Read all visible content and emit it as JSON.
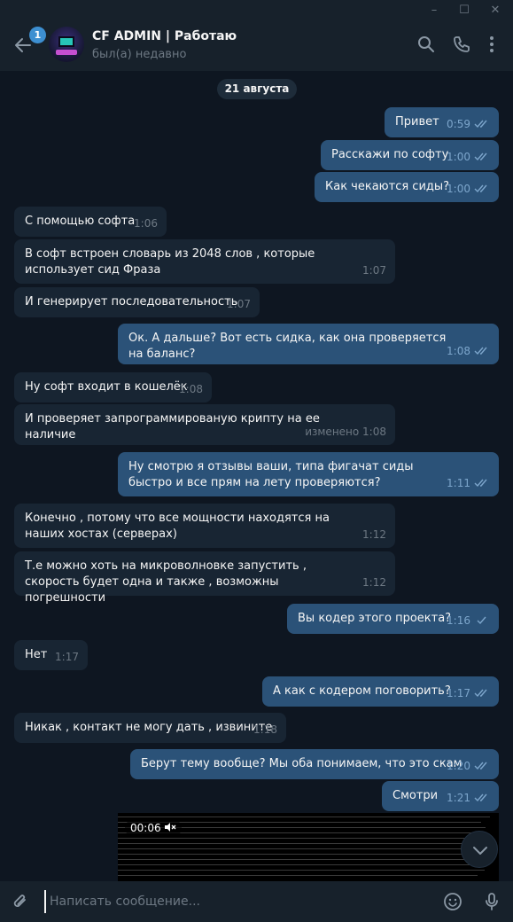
{
  "header": {
    "title": "CF ADMIN | Работаю",
    "status": "был(а) недавно",
    "unread_badge": "1"
  },
  "date_separator": "21 августа",
  "messages": [
    {
      "dir": "out",
      "text": "Привет",
      "time": "0:59",
      "read": true
    },
    {
      "dir": "out",
      "text": "Расскажи по софту",
      "time": "1:00",
      "read": true
    },
    {
      "dir": "out",
      "text": "Как чекаются сиды?",
      "time": "1:00",
      "read": true
    },
    {
      "dir": "in",
      "text": "С помощью софта",
      "time": "1:06"
    },
    {
      "dir": "in",
      "text": "В софт встроен словарь из 2048 слов , которые использует сид Фраза",
      "time": "1:07"
    },
    {
      "dir": "in",
      "text": "И генерирует последовательность",
      "time": "1:07"
    },
    {
      "dir": "out",
      "text": "Ок. А дальше? Вот есть сидка, как она проверяется на баланс?",
      "time": "1:08",
      "read": true
    },
    {
      "dir": "in",
      "text": "Ну софт входит в кошелёк",
      "time": "1:08"
    },
    {
      "dir": "in",
      "text": "И проверяет запрограммированую крипту на ее наличие",
      "time": "изменено 1:08"
    },
    {
      "dir": "out",
      "text": "Ну смотрю я отзывы ваши, типа фигачат сиды быстро и все прям на лету проверяются?",
      "time": "1:11",
      "read": true
    },
    {
      "dir": "in",
      "text": "Конечно , потому что все мощности находятся на наших хостах (серверах)",
      "time": "1:12"
    },
    {
      "dir": "in",
      "text": "Т.е можно хоть на микроволновке запустить , скорость будет одна и также , возможны погрешности",
      "time": "1:12"
    },
    {
      "dir": "out",
      "text": "Вы кодер этого проекта?",
      "time": "1:16",
      "read": false
    },
    {
      "dir": "in",
      "text": "Нет",
      "time": "1:17"
    },
    {
      "dir": "out",
      "text": "А как с кодером поговорить?",
      "time": "1:17",
      "read": true
    },
    {
      "dir": "in",
      "text": "Никак , контакт не могу дать , извините",
      "time": "1:18"
    },
    {
      "dir": "out",
      "text": "Берут тему вообще? Мы оба понимаем, что это скам",
      "time": "1:20",
      "read": true
    },
    {
      "dir": "out",
      "text": "Смотри",
      "time": "1:21",
      "read": true
    }
  ],
  "video": {
    "duration": "00:06",
    "muted": true
  },
  "composer": {
    "placeholder": "Написать сообщение..."
  },
  "colors": {
    "background": "#0e1621",
    "incoming": "#182533",
    "outgoing": "#2b5278",
    "header": "#17212b",
    "accent": "#3d8fd1"
  },
  "icons": [
    "back-arrow-icon",
    "search-icon",
    "phone-icon",
    "more-vert-icon",
    "attach-icon",
    "emoji-icon",
    "mic-icon",
    "chevron-down-icon",
    "speaker-muted-icon"
  ]
}
